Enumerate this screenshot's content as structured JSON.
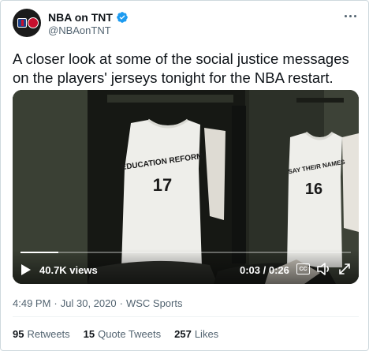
{
  "author": {
    "display_name": "NBA on TNT",
    "handle": "@NBAonTNT",
    "verified": true,
    "avatar_icon": "nba-on-tnt-logo",
    "more_icon": "more-options-icon"
  },
  "tweet": {
    "text": "A closer look at some of the social justice messages on the players' jerseys tonight for the NBA restart."
  },
  "video": {
    "views": "40.7K views",
    "time": "0:03 / 0:26",
    "cc_label": "CC",
    "progress": 0.115,
    "jersey_left": {
      "message": "EDUCATION REFORM",
      "number": "17"
    },
    "jersey_right": {
      "message": "SAY THEIR NAMES",
      "number": "16"
    }
  },
  "meta": {
    "time": "4:49 PM",
    "separator": "·",
    "date": "Jul 30, 2020",
    "source": "WSC Sports"
  },
  "stats": {
    "retweets_count": "95",
    "retweets_label": "Retweets",
    "quotes_count": "15",
    "quotes_label": "Quote Tweets",
    "likes_count": "257",
    "likes_label": "Likes"
  },
  "colors": {
    "text_primary": "#0f1419",
    "text_secondary": "#536471",
    "verified_blue": "#1d9bf0",
    "border": "#cfd9de"
  }
}
